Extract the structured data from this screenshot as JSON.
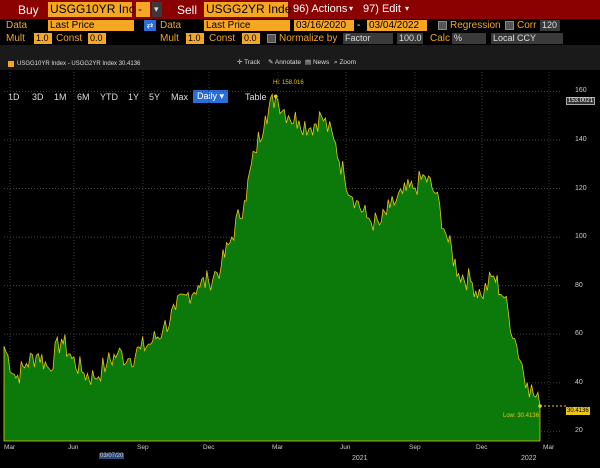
{
  "topbar": {
    "buy_label": "Buy",
    "buy_value": "USGG10YR Inc",
    "dash": "-",
    "sell_label": "Sell",
    "sell_value": "USGG2YR Inde",
    "actions_label": "96) Actions",
    "edit_label": "97) Edit"
  },
  "row2": {
    "data_label": "Data",
    "data_value": "Last Price",
    "data2_label": "Data",
    "data2_value": "Last Price",
    "date_from": "03/16/2020",
    "date_sep": "-",
    "date_to": "03/04/2022",
    "regression_label": "Regression",
    "corr_label": "Corr",
    "corr_value": "120"
  },
  "row3": {
    "mult_label": "Mult",
    "mult_value": "1.0",
    "const_label": "Const",
    "const_value": "0.0",
    "mult2_label": "Mult",
    "mult2_value": "1.0",
    "const2_label": "Const",
    "const2_value": "0.0",
    "normalize_label": "Normalize by",
    "normalize_value": "Factor",
    "factor_value": "100.0",
    "calc_label": "Calc",
    "calc_value": "%",
    "ccy_value": "Local CCY"
  },
  "tabs": [
    "1D",
    "3D",
    "1M",
    "6M",
    "YTD",
    "1Y",
    "5Y",
    "Max",
    "Daily",
    "Table"
  ],
  "toolbar": {
    "legend": "USGG10YR Index - USGG2YR Index 30.4136",
    "track": "Track",
    "annotate": "Annotate",
    "news": "News",
    "zoom": "Zoom"
  },
  "chart_data": {
    "type": "area",
    "title": "USGG10YR Index - USGG2YR Index",
    "series": [
      {
        "name": "USGG10YR Index - USGG2YR Index",
        "color": "#0b7a0b"
      }
    ],
    "x_ticks": [
      "Mar",
      "Jun",
      "Sep",
      "Dec",
      "Mar",
      "Jun",
      "Sep",
      "Dec",
      "Mar"
    ],
    "year_labels": [
      "2021",
      "2022"
    ],
    "start_date_label": "03/07/20",
    "y_ticks": [
      20,
      40,
      60,
      80,
      100,
      120,
      140,
      160
    ],
    "ylim": [
      16,
      168
    ],
    "high_label": "Hi: 158.016",
    "low_label": "Low: 30.4136",
    "last_value": "30.4136",
    "ref_value": "153.0021",
    "x": [
      "2020-03-16",
      "2020-04-01",
      "2020-04-15",
      "2020-05-01",
      "2020-05-15",
      "2020-06-01",
      "2020-06-15",
      "2020-07-01",
      "2020-07-15",
      "2020-08-01",
      "2020-08-15",
      "2020-09-01",
      "2020-09-15",
      "2020-10-01",
      "2020-10-15",
      "2020-11-01",
      "2020-11-15",
      "2020-12-01",
      "2020-12-15",
      "2021-01-01",
      "2021-01-15",
      "2021-02-01",
      "2021-02-15",
      "2021-03-01",
      "2021-03-15",
      "2021-04-01",
      "2021-04-15",
      "2021-05-01",
      "2021-05-15",
      "2021-06-01",
      "2021-06-15",
      "2021-07-01",
      "2021-07-15",
      "2021-08-01",
      "2021-08-15",
      "2021-09-01",
      "2021-09-15",
      "2021-10-01",
      "2021-10-15",
      "2021-11-01",
      "2021-11-15",
      "2021-12-01",
      "2021-12-15",
      "2022-01-01",
      "2022-01-15",
      "2022-02-01",
      "2022-02-15",
      "2022-03-04"
    ],
    "values": [
      55,
      42,
      48,
      52,
      46,
      58,
      50,
      44,
      42,
      48,
      52,
      50,
      54,
      57,
      62,
      70,
      76,
      80,
      82,
      88,
      100,
      115,
      135,
      150,
      158,
      150,
      148,
      145,
      150,
      140,
      125,
      115,
      108,
      105,
      112,
      118,
      120,
      125,
      118,
      98,
      85,
      82,
      76,
      84,
      75,
      55,
      40,
      30.4
    ]
  },
  "colors": {
    "accent": "#f5a623",
    "topbar": "#8b0000",
    "series": "#0b7a0b",
    "active_tab": "#2a6fd6"
  }
}
